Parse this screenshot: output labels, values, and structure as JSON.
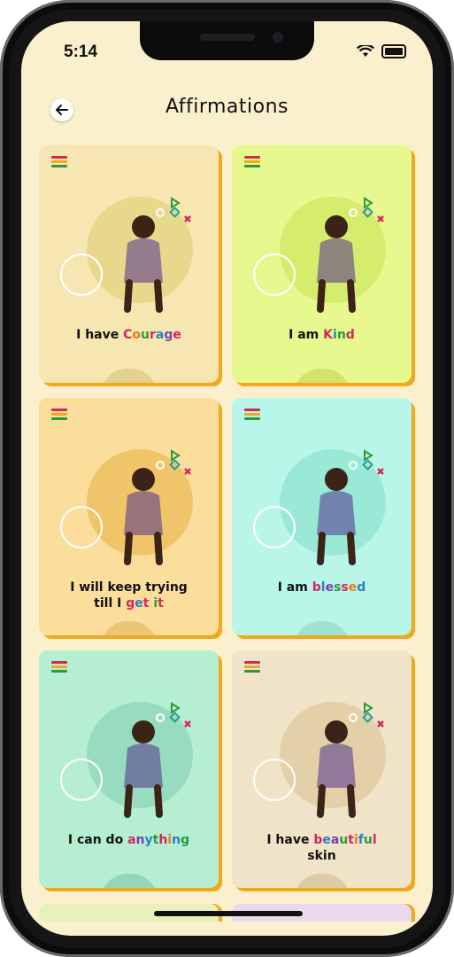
{
  "status": {
    "time": "5:14"
  },
  "header": {
    "title": "Affirmations"
  },
  "cards": [
    {
      "pre": "I have ",
      "mid": "Courage",
      "post": "",
      "line2": "",
      "bg": "#f6e7b2",
      "circle": "#e8d88c",
      "bump": "#e3d18f",
      "colors": [
        "#d6275a",
        "#ea7a1a",
        "#2a9b3b",
        "#d6275a",
        "#2a7fc7",
        "#7a3fb2",
        "#d6275a"
      ]
    },
    {
      "pre": "I am ",
      "mid": "Kind",
      "post": "",
      "line2": "",
      "bg": "#e7f88e",
      "circle": "#d6ec6d",
      "bump": "#d3e36c",
      "colors": [
        "#d6275a",
        "#2a7fc7",
        "#2a9b3b",
        "#d6275a"
      ]
    },
    {
      "pre": "I will keep trying",
      "mid": "",
      "post": "",
      "line2pre": "till I ",
      "line2mid": "get it",
      "bg": "#fbdd9c",
      "circle": "#f0c469",
      "bump": "#ecc677",
      "colors": [
        "#d6275a",
        "#2a7fc7",
        "#d6275a",
        "#7a3fb2",
        "#2a9b3b"
      ]
    },
    {
      "pre": "I am ",
      "mid": "blessed",
      "post": "",
      "line2": "",
      "bg": "#baf6e7",
      "circle": "#9ae9d6",
      "bump": "#9fe3d2",
      "colors": [
        "#d6275a",
        "#2a7fc7",
        "#7a3fb2",
        "#2a9b3b",
        "#d6275a",
        "#ea7a1a",
        "#2a7fc7"
      ]
    },
    {
      "pre": "I can do ",
      "mid": "anything",
      "post": "",
      "line2": "",
      "bg": "#b6eed2",
      "circle": "#98dcc0",
      "bump": "#94d6bc",
      "colors": [
        "#d6275a",
        "#7a3fb2",
        "#2a7fc7",
        "#2a9b3b",
        "#d6275a",
        "#ea7a1a",
        "#2a7fc7",
        "#2a9b3b"
      ]
    },
    {
      "pre": "I have ",
      "mid": "beautiful",
      "post": "",
      "line2": "skin",
      "bg": "#efe3c8",
      "circle": "#e1d0a8",
      "bump": "#dccba4",
      "colors": [
        "#d6275a",
        "#2a7fc7",
        "#7a3fb2",
        "#2a9b3b",
        "#d6275a",
        "#ea7a1a",
        "#2a7fc7",
        "#2a9b3b",
        "#d6275a"
      ]
    }
  ]
}
